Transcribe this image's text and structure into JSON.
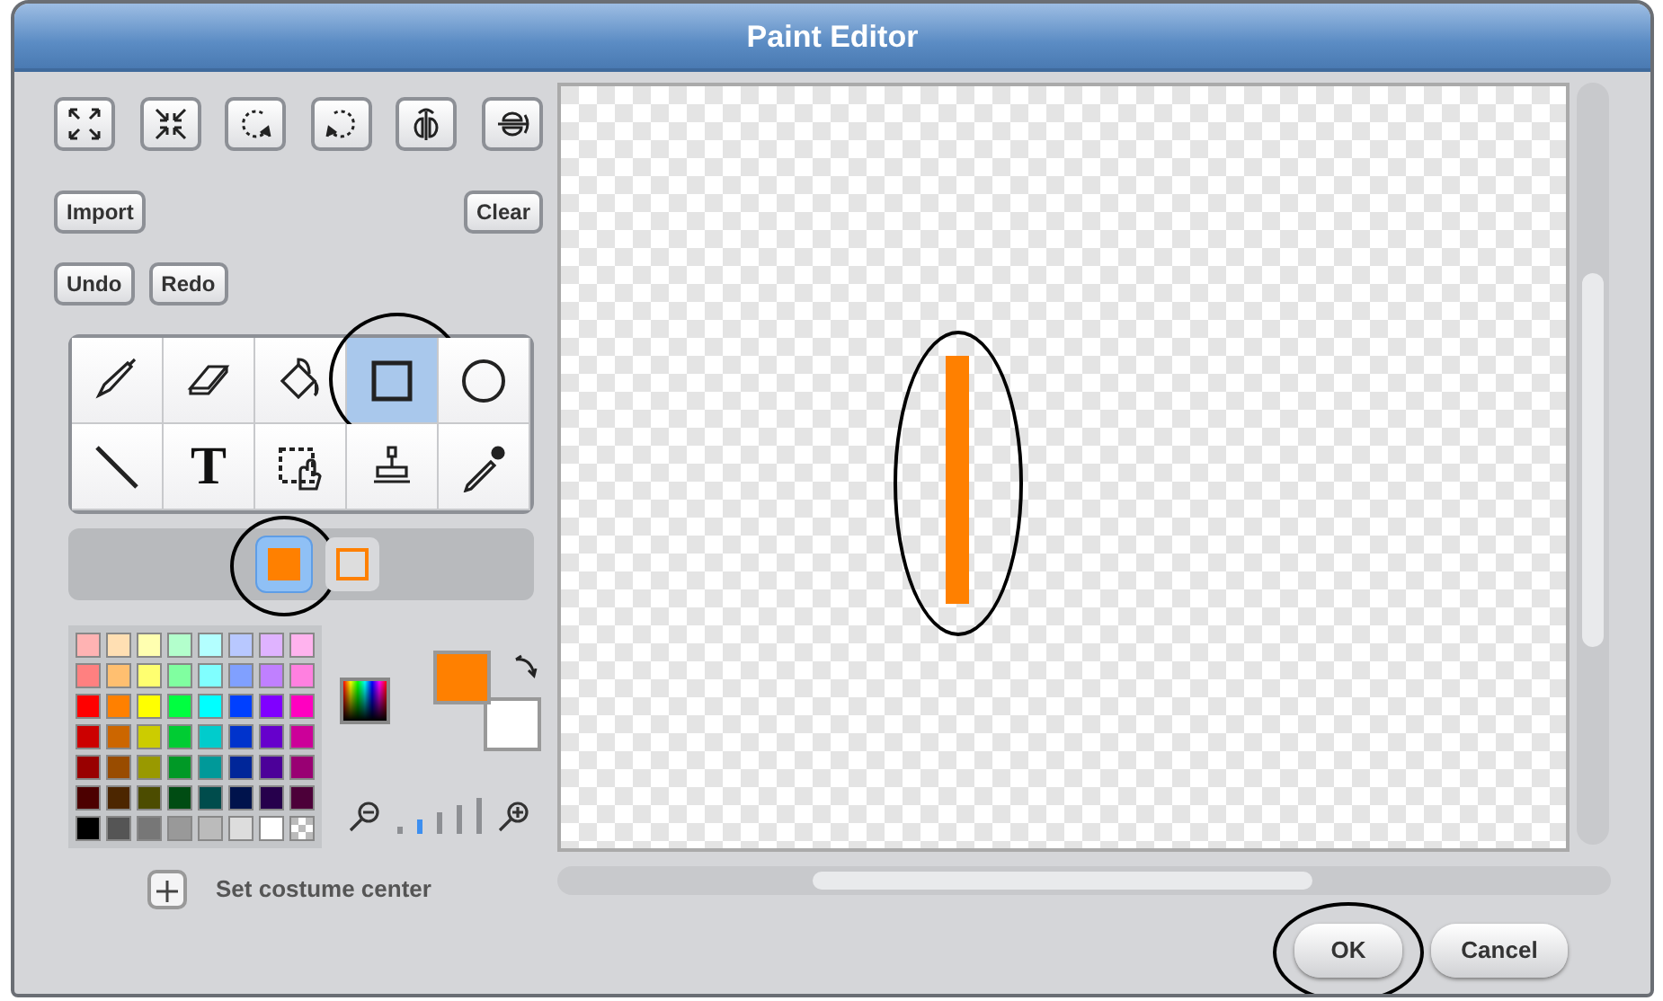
{
  "window": {
    "title": "Paint Editor"
  },
  "transform_buttons": [
    {
      "kind": "grow"
    },
    {
      "kind": "shrink"
    },
    {
      "kind": "rotate-left"
    },
    {
      "kind": "rotate-right"
    },
    {
      "kind": "flip-horizontal"
    },
    {
      "kind": "flip-vertical"
    }
  ],
  "edit_buttons": [
    {
      "label": "Import"
    },
    {
      "label": "Clear"
    }
  ],
  "history_buttons": [
    {
      "label": "Undo"
    },
    {
      "label": "Redo"
    }
  ],
  "tools": [
    {
      "kind": "brush",
      "selected": false,
      "circled": false
    },
    {
      "kind": "eraser",
      "selected": false,
      "circled": false
    },
    {
      "kind": "fill",
      "selected": false,
      "circled": false
    },
    {
      "kind": "rectangle",
      "selected": true,
      "circled": true
    },
    {
      "kind": "ellipse",
      "selected": false,
      "circled": false
    },
    {
      "kind": "line",
      "selected": false,
      "circled": false
    },
    {
      "kind": "text",
      "label": "T",
      "selected": false,
      "circled": false
    },
    {
      "kind": "select",
      "selected": false,
      "circled": false
    },
    {
      "kind": "stamp",
      "selected": false,
      "circled": false
    },
    {
      "kind": "eyedropper",
      "selected": false,
      "circled": false
    }
  ],
  "fill_modes": [
    {
      "kind": "filled",
      "selected": true,
      "circled": true
    },
    {
      "kind": "outline",
      "selected": false,
      "circled": false
    }
  ],
  "palette": [
    [
      {
        "color": "#ffb3b3"
      },
      {
        "color": "#ffdfb3"
      },
      {
        "color": "#ffffb0"
      },
      {
        "color": "#b3ffcc"
      },
      {
        "color": "#b3ffff"
      },
      {
        "color": "#b8c8ff"
      },
      {
        "color": "#dfb3ff"
      },
      {
        "color": "#ffb3ee"
      }
    ],
    [
      {
        "color": "#ff8080"
      },
      {
        "color": "#ffbf70"
      },
      {
        "color": "#ffff70"
      },
      {
        "color": "#80ffa0"
      },
      {
        "color": "#80ffff"
      },
      {
        "color": "#80a0ff"
      },
      {
        "color": "#c080ff"
      },
      {
        "color": "#ff80e0"
      }
    ],
    [
      {
        "color": "#ff0000"
      },
      {
        "color": "#ff8000"
      },
      {
        "color": "#ffff00"
      },
      {
        "color": "#00ff40"
      },
      {
        "color": "#00ffff"
      },
      {
        "color": "#0040ff"
      },
      {
        "color": "#8000ff"
      },
      {
        "color": "#ff00c0"
      }
    ],
    [
      {
        "color": "#cc0000"
      },
      {
        "color": "#cc6600"
      },
      {
        "color": "#cccc00"
      },
      {
        "color": "#00cc33"
      },
      {
        "color": "#00cccc"
      },
      {
        "color": "#0033cc"
      },
      {
        "color": "#6600cc"
      },
      {
        "color": "#cc0099"
      }
    ],
    [
      {
        "color": "#990000"
      },
      {
        "color": "#994c00"
      },
      {
        "color": "#999900"
      },
      {
        "color": "#009926"
      },
      {
        "color": "#009999"
      },
      {
        "color": "#002699"
      },
      {
        "color": "#4c0099"
      },
      {
        "color": "#990073"
      }
    ],
    [
      {
        "color": "#4c0000"
      },
      {
        "color": "#4c2600"
      },
      {
        "color": "#4c4c00"
      },
      {
        "color": "#004c13"
      },
      {
        "color": "#004c4c"
      },
      {
        "color": "#00134c"
      },
      {
        "color": "#26004c"
      },
      {
        "color": "#4c0039"
      }
    ],
    [
      {
        "color": "#000000"
      },
      {
        "color": "#555555"
      },
      {
        "color": "#777777"
      },
      {
        "color": "#999999"
      },
      {
        "color": "#bbbbbb"
      },
      {
        "color": "#dddddd"
      },
      {
        "color": "#ffffff"
      },
      {
        "kind": "transparent"
      }
    ]
  ],
  "current_colors": [
    {
      "kind": "foreground",
      "color": "#ff8000"
    },
    {
      "kind": "background",
      "color": "#ffffff"
    }
  ],
  "zoom_levels": [
    {
      "selected": false
    },
    {
      "selected": true
    },
    {
      "selected": false
    },
    {
      "selected": false
    },
    {
      "selected": false
    }
  ],
  "costume_center": {
    "label": "Set costume center"
  },
  "canvas": {
    "shapes": [
      {
        "kind": "rectangle",
        "color": "#ff8000",
        "circled": true
      }
    ]
  },
  "dialog_buttons": [
    {
      "label": "OK",
      "circled": true
    },
    {
      "label": "Cancel",
      "circled": false
    }
  ]
}
